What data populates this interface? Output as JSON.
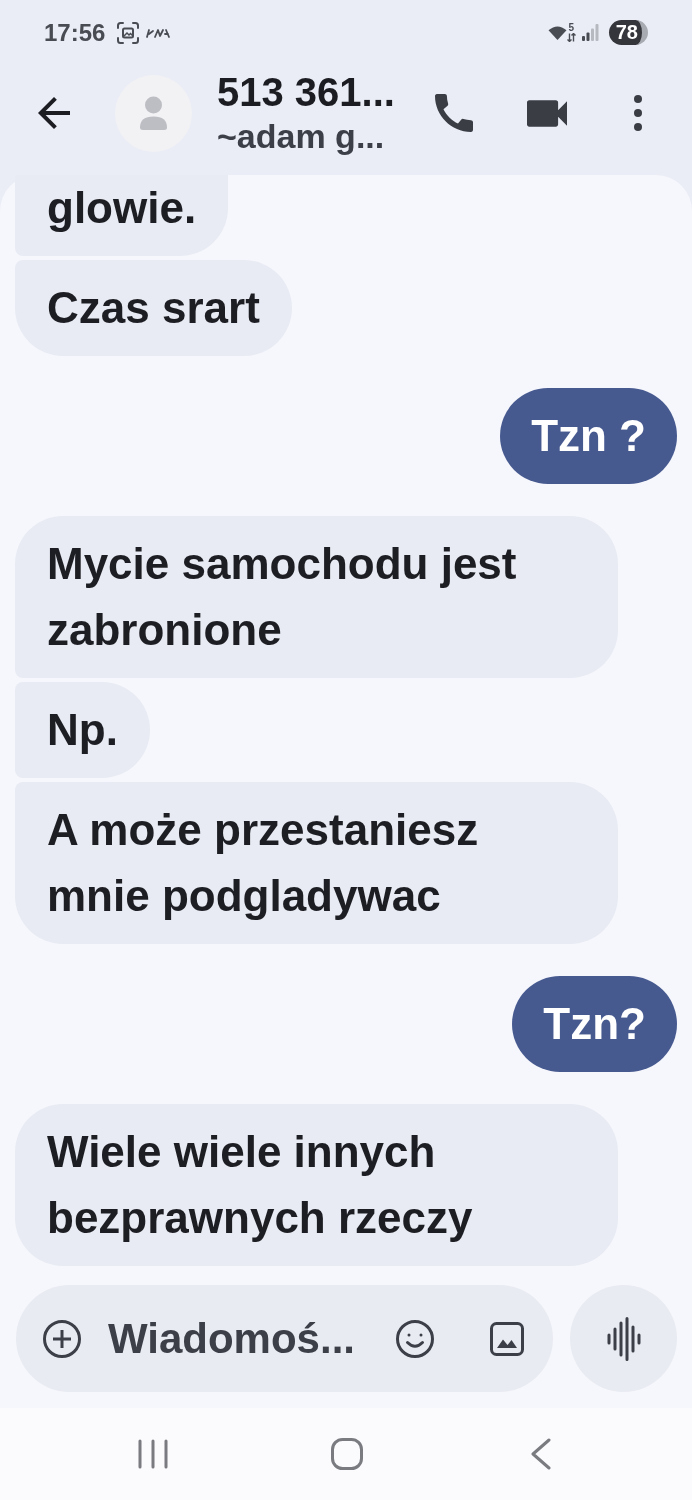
{
  "status_bar": {
    "time": "17:56",
    "wifi_band": "5",
    "battery": "78"
  },
  "header": {
    "title": "513 361...",
    "subtitle": "~adam g..."
  },
  "messages": [
    {
      "kind": "received",
      "text": "glowie."
    },
    {
      "kind": "received",
      "text": "Czas srart"
    },
    {
      "kind": "sent",
      "text": "Tzn ?"
    },
    {
      "kind": "received",
      "text": "Mycie samochodu jest zabronione"
    },
    {
      "kind": "received",
      "text": "Np."
    },
    {
      "kind": "received",
      "text": "A może przestaniesz mnie podgladywac"
    },
    {
      "kind": "sent",
      "text": "Tzn?"
    },
    {
      "kind": "received",
      "text": "Wiele wiele innych bezprawnych rzeczy"
    }
  ],
  "composer": {
    "placeholder": "Wiadomoś..."
  }
}
